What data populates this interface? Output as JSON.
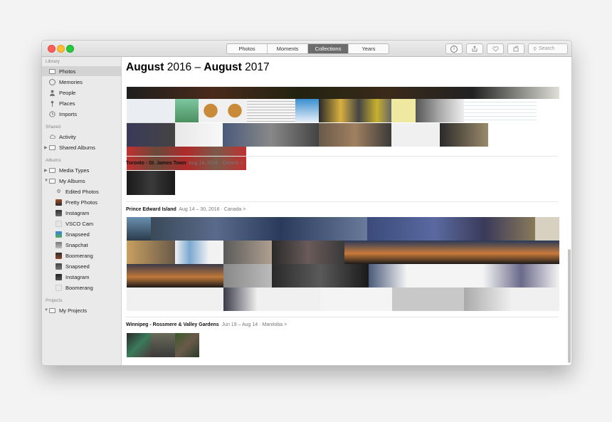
{
  "toolbar": {
    "tabs": [
      {
        "label": "Photos",
        "active": false
      },
      {
        "label": "Moments",
        "active": false
      },
      {
        "label": "Collections",
        "active": true
      },
      {
        "label": "Years",
        "active": false
      }
    ],
    "search_placeholder": "Search",
    "buttons": [
      "info-icon",
      "share-icon",
      "heart-icon",
      "rotate-icon"
    ]
  },
  "sidebar": {
    "library_header": "Library",
    "library": [
      {
        "label": "Photos",
        "icon": "photos-icon",
        "selected": true
      },
      {
        "label": "Memories",
        "icon": "memories-icon"
      },
      {
        "label": "People",
        "icon": "people-icon"
      },
      {
        "label": "Places",
        "icon": "pin-icon"
      },
      {
        "label": "Imports",
        "icon": "clock-icon"
      }
    ],
    "shared_header": "Shared",
    "shared": [
      {
        "label": "Activity",
        "icon": "cloud-icon"
      },
      {
        "label": "Shared Albums",
        "icon": "folder-icon"
      }
    ],
    "albums_header": "Albums",
    "albums": [
      {
        "label": "Media Types",
        "icon": "folder-icon"
      },
      {
        "label": "My Albums",
        "icon": "folder-icon"
      },
      {
        "label": "Edited Photos",
        "icon": "gear-icon"
      },
      {
        "label": "Pretty Photos",
        "icon": "album-icon"
      },
      {
        "label": "Instagram",
        "icon": "album-icon"
      },
      {
        "label": "VSCO Cam",
        "icon": "album-icon"
      },
      {
        "label": "Snapseed",
        "icon": "album-icon"
      },
      {
        "label": "Snapchat",
        "icon": "album-icon"
      },
      {
        "label": "Boomerang",
        "icon": "album-icon"
      },
      {
        "label": "Snapseed",
        "icon": "album-icon"
      },
      {
        "label": "Instagram",
        "icon": "album-icon"
      },
      {
        "label": "Boomerang",
        "icon": "album-icon"
      }
    ],
    "projects_header": "Projects",
    "projects": [
      {
        "label": "My Projects",
        "icon": "folder-icon"
      }
    ]
  },
  "main": {
    "title_start_month": "August",
    "title_start_year": " 2016",
    "title_sep": " – ",
    "title_end_month": "August",
    "title_end_year": " 2017",
    "collections": [
      {
        "name": "Toronto - St. James Town",
        "date": "Aug 14, 2016",
        "sep": "·",
        "region": "Ontario",
        "chevron": ">"
      },
      {
        "name": "Prince Edward Island",
        "date": "Aug 14 – 30, 2016",
        "sep": "·",
        "region": "Canada",
        "chevron": ">"
      },
      {
        "name": "Winnipeg - Rossmere & Valley Gardens",
        "date": "Jun 19 – Aug 14",
        "sep": "·",
        "region": "Manitoba",
        "chevron": ">"
      }
    ]
  },
  "colors": {
    "tab_active": "#6c6c6c",
    "sidebar_bg": "#eaeaea",
    "sidebar_selected": "#d3d3d3"
  }
}
